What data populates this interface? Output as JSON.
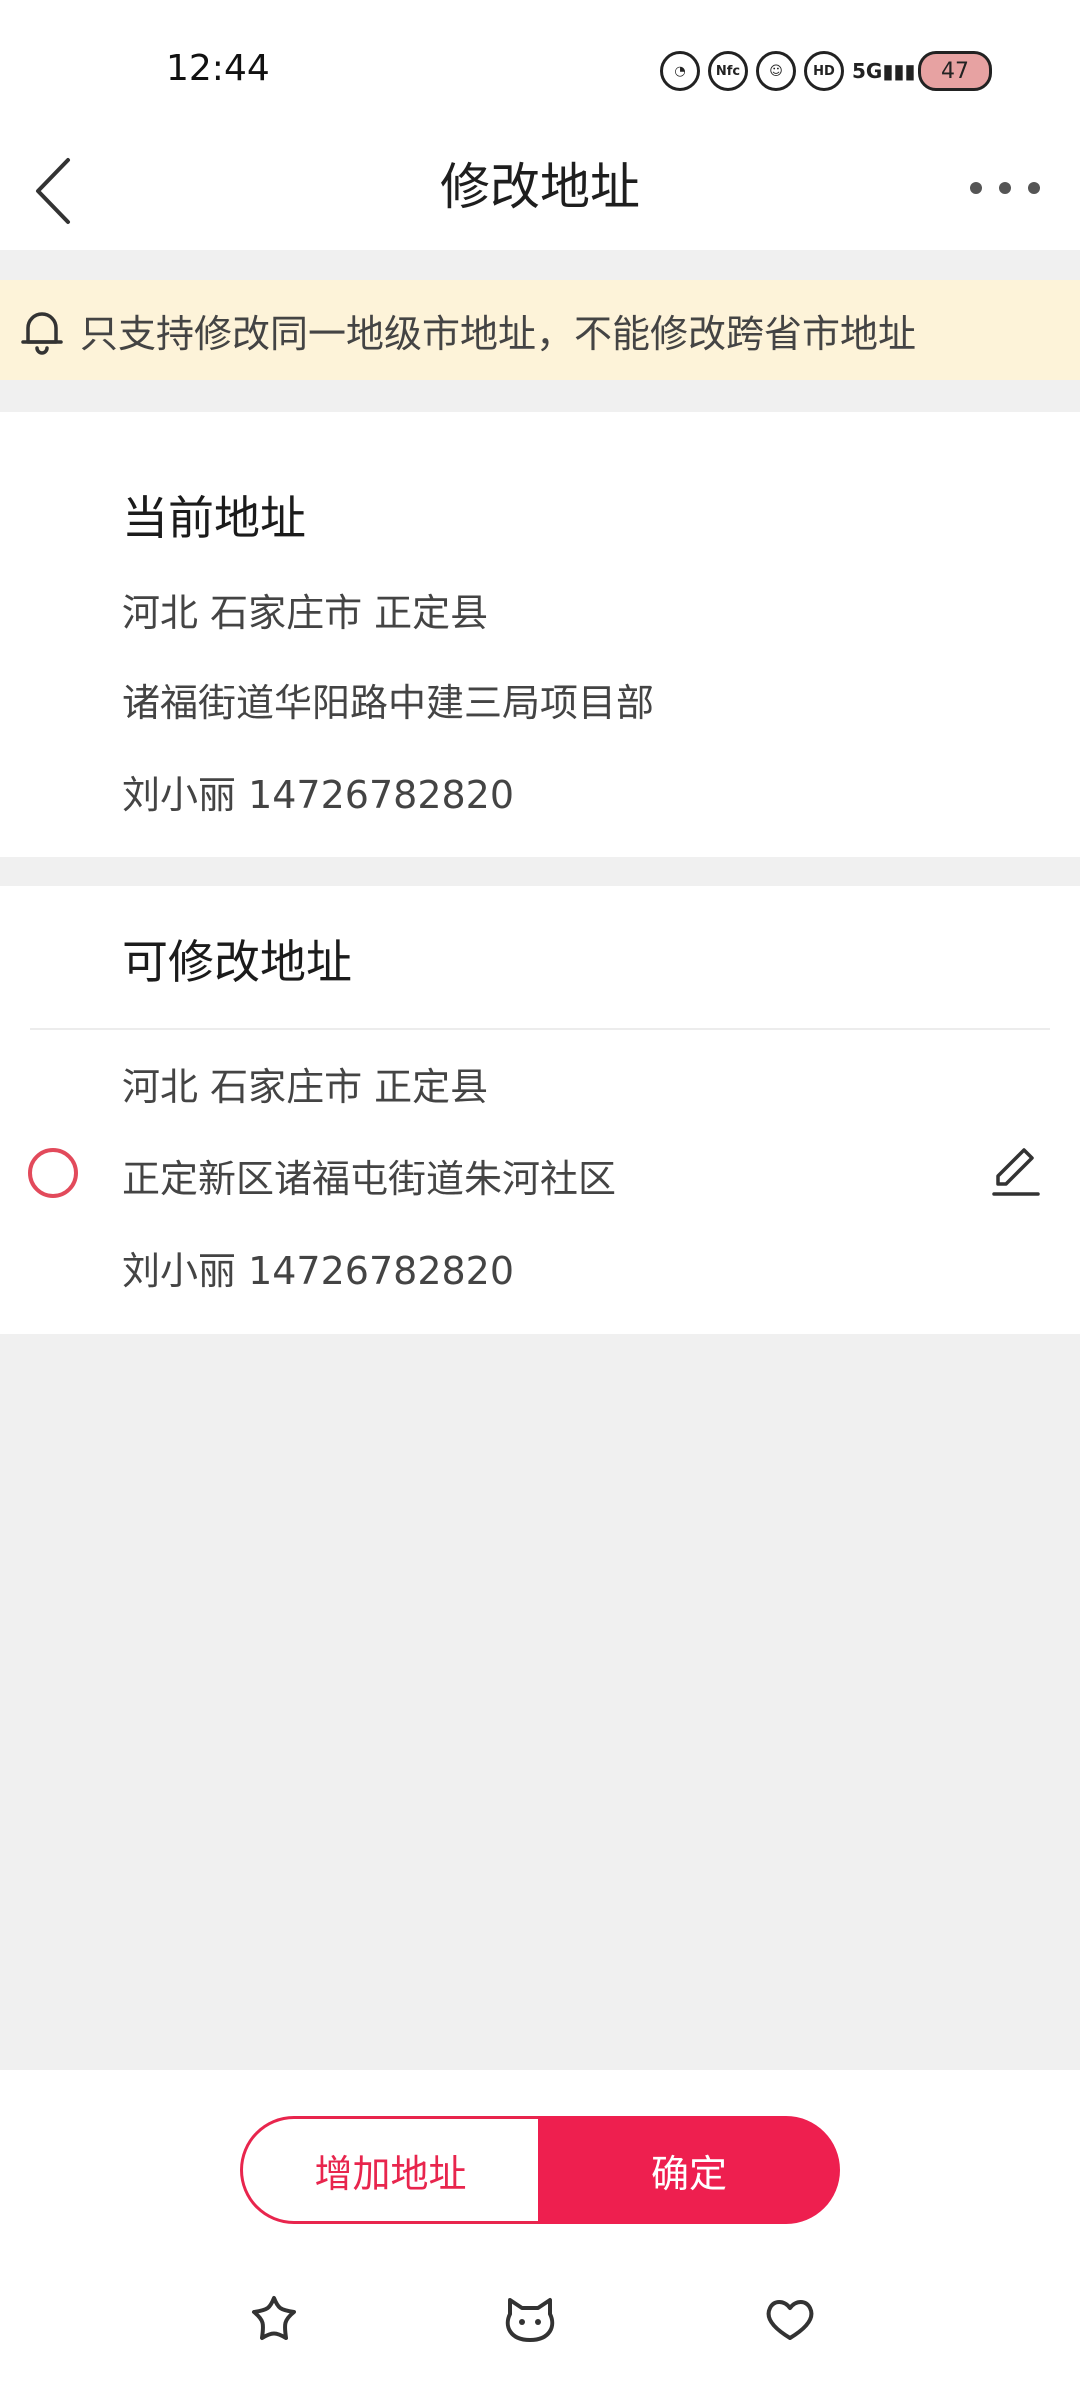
{
  "status_bar": {
    "time": "12:44",
    "icons": [
      "assistant-icon",
      "nfc-icon",
      "smile-icon",
      "hd-icon",
      "5g-signal-icon",
      "battery-icon"
    ],
    "nfc_label": "Nfc",
    "hd_label": "HD",
    "signal_label": "5G",
    "battery_level": "47"
  },
  "header": {
    "title": "修改地址"
  },
  "notice": {
    "text": "只支持修改同一地级市地址，不能修改跨省市地址",
    "background": "#fdf3d9"
  },
  "current_address": {
    "heading": "当前地址",
    "region": "河北 石家庄市 正定县",
    "street": "诸福街道华阳路中建三局项目部",
    "contact": "刘小丽 14726782820"
  },
  "editable_address": {
    "heading": "可修改地址",
    "region": "河北 石家庄市 正定县",
    "street": "正定新区诸福屯街道朱河社区",
    "contact": "刘小丽 14726782820",
    "selected": false
  },
  "actions": {
    "add_label": "增加地址",
    "confirm_label": "确定",
    "accent_color": "#ee1f4f"
  },
  "bottom_nav": [
    "star-icon",
    "cat-face-icon",
    "heart-icon"
  ]
}
